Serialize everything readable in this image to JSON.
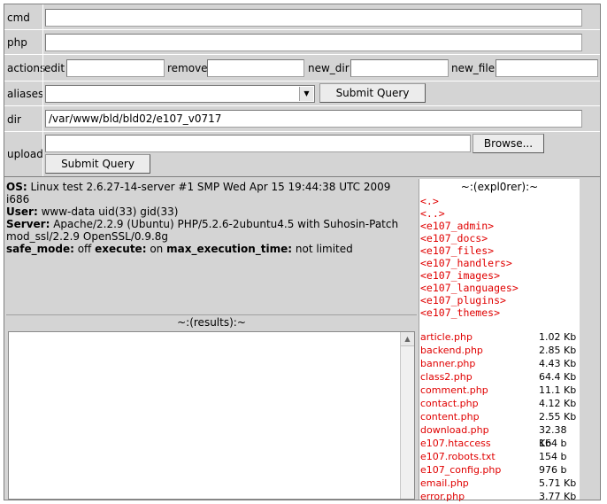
{
  "form": {
    "cmd_label": "cmd",
    "php_label": "php",
    "actions_label": "actions",
    "edit_label": "edit",
    "remove_label": "remove",
    "new_dir_label": "new_dir",
    "new_file_label": "new_file",
    "aliases_label": "aliases",
    "aliases_value": "",
    "submit_label": "Submit Query",
    "dir_label": "dir",
    "dir_value": "/var/www/bld/bld02/e107_v0717",
    "upload_label": "upload",
    "browse_label": "Browse..."
  },
  "info": {
    "os_label": "OS:",
    "os_value": "Linux test 2.6.27-14-server #1 SMP Wed Apr 15 19:44:38 UTC 2009 i686",
    "user_label": "User:",
    "user_value": "www-data uid(33) gid(33)",
    "server_label": "Server:",
    "server_value": "Apache/2.2.9 (Ubuntu) PHP/5.2.6-2ubuntu4.5 with Suhosin-Patch mod_ssl/2.2.9 OpenSSL/0.9.8g",
    "safe_mode_label": "safe_mode:",
    "safe_mode_value": "off",
    "execute_label": "execute:",
    "execute_value": "on",
    "max_exec_label": "max_execution_time:",
    "max_exec_value": "not limited"
  },
  "results": {
    "title": "~:(results):~"
  },
  "explorer": {
    "title": "~:(expl0rer):~",
    "dirs": [
      "<.>",
      "<..>",
      "<e107_admin>",
      "<e107_docs>",
      "<e107_files>",
      "<e107_handlers>",
      "<e107_images>",
      "<e107_languages>",
      "<e107_plugins>",
      "<e107_themes>"
    ],
    "files": [
      {
        "name": "article.php",
        "size": "1.02 Kb"
      },
      {
        "name": "backend.php",
        "size": "2.85 Kb"
      },
      {
        "name": "banner.php",
        "size": "4.43 Kb"
      },
      {
        "name": "class2.php",
        "size": "64.4 Kb"
      },
      {
        "name": "comment.php",
        "size": "11.1 Kb"
      },
      {
        "name": "contact.php",
        "size": "4.12 Kb"
      },
      {
        "name": "content.php",
        "size": "2.55 Kb"
      },
      {
        "name": "download.php",
        "size": "32.38 Kb"
      },
      {
        "name": "e107.htaccess",
        "size": "164 b"
      },
      {
        "name": "e107.robots.txt",
        "size": "154 b"
      },
      {
        "name": "e107_config.php",
        "size": "976 b"
      },
      {
        "name": "email.php",
        "size": "5.71 Kb"
      },
      {
        "name": "error.php",
        "size": "3.77 Kb"
      }
    ]
  },
  "colors": {
    "link": "#e00000",
    "panel": "#d4d4d4"
  }
}
